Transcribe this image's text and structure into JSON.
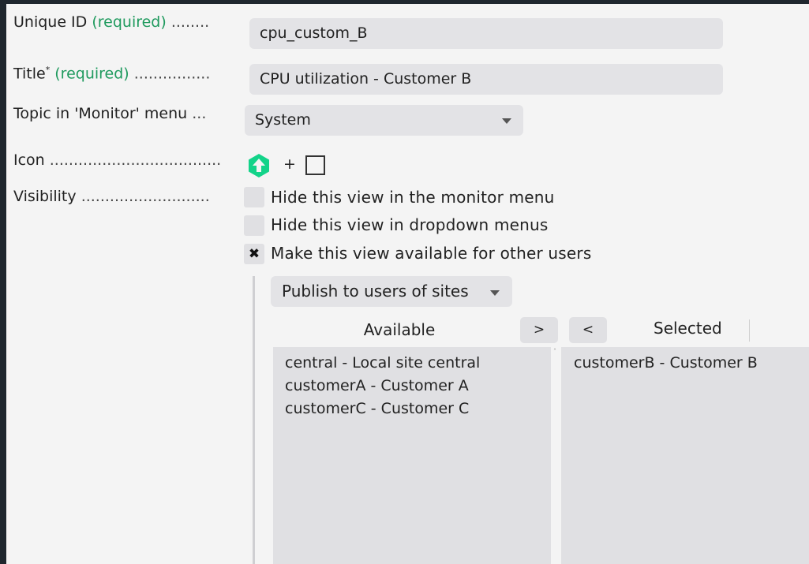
{
  "form": {
    "unique_id": {
      "label": "Unique ID",
      "required": "(required)",
      "dots": "........",
      "value": "cpu_custom_B"
    },
    "title": {
      "label": "Title",
      "asterisk": "*",
      "required": "(required)",
      "dots": "................",
      "value": "CPU utilization - Customer B"
    },
    "topic": {
      "label": "Topic in 'Monitor' menu",
      "dots": "...",
      "value": "System"
    },
    "icon": {
      "label": "Icon",
      "dots": "....................................",
      "plus": "+"
    },
    "visibility": {
      "label": "Visibility",
      "dots": "...........................",
      "options": [
        {
          "label": "Hide this view in the monitor menu",
          "checked": false
        },
        {
          "label": "Hide this view in dropdown menus",
          "checked": false
        },
        {
          "label": "Make this view available for other users",
          "checked": true,
          "mark": "✖"
        }
      ]
    },
    "publish": {
      "dropdown_label": "Publish to users of sites",
      "available_header": "Available",
      "selected_header": "Selected",
      "add_button": ">",
      "remove_button": "<",
      "available": [
        "central - Local site central",
        "customerA - Customer A",
        "customerC - Customer C"
      ],
      "selected": [
        "customerB - Customer B"
      ]
    }
  },
  "colors": {
    "background_dark": "#1f272e",
    "panel": "#f4f4f4",
    "field": "#e3e3e6",
    "required_green": "#1f9a5e",
    "icon_green": "#13d389"
  }
}
